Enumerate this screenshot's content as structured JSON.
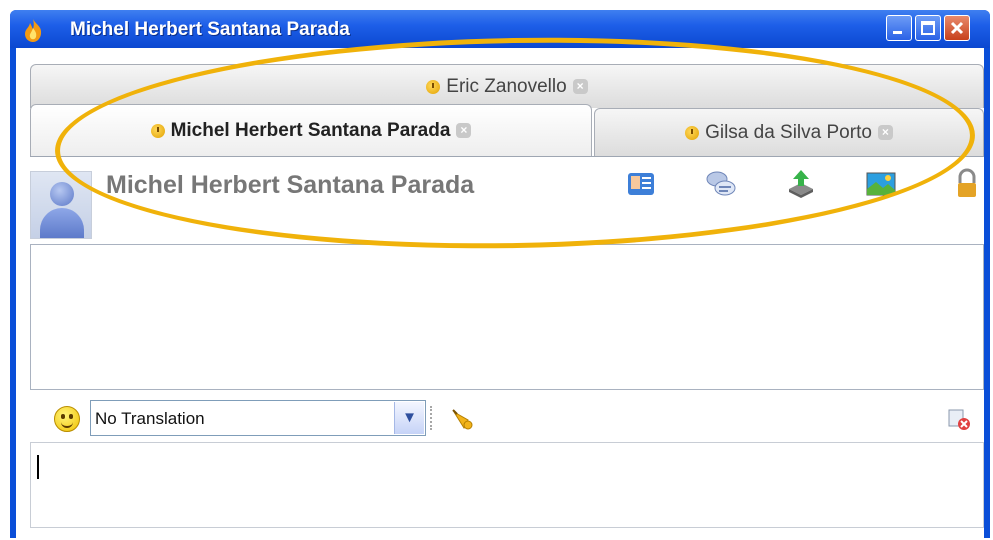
{
  "window": {
    "title": "Michel Herbert Santana Parada",
    "icon": "flame-app-icon",
    "controls": [
      "minimize",
      "maximize",
      "close"
    ]
  },
  "tabs": {
    "back_row": [
      {
        "label": "Eric Zanovello",
        "status_icon": "clock-icon"
      }
    ],
    "front_row": [
      {
        "label": "Michel Herbert Santana Parada",
        "status_icon": "clock-icon",
        "active": true
      },
      {
        "label": "Gilsa da Silva Porto",
        "status_icon": "clock-icon",
        "active": false
      }
    ]
  },
  "contact": {
    "name": "Michel Herbert Santana Parada",
    "tools": [
      "contact-card-icon",
      "chat-bubbles-icon",
      "send-file-icon",
      "picture-icon",
      "lock-icon"
    ]
  },
  "compose": {
    "translation_value": "No Translation",
    "emoticon_icon": "smiley-icon",
    "nudge_icon": "bell-icon",
    "clear_icon": "clear-history-icon"
  },
  "colors": {
    "titlebar": "#0a4ed8",
    "highlight": "#f0b20a"
  }
}
